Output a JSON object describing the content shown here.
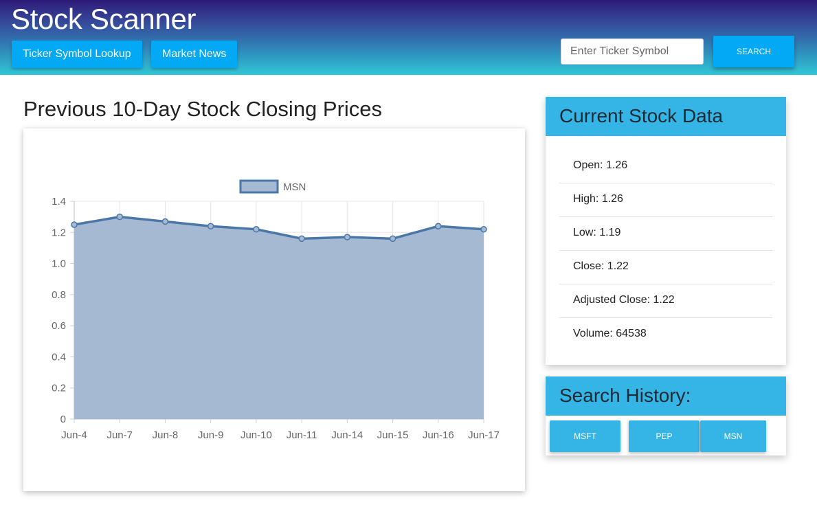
{
  "header": {
    "app_title": "Stock Scanner",
    "nav": {
      "lookup_label": "Ticker Symbol Lookup",
      "news_label": "Market News"
    },
    "search": {
      "placeholder": "Enter Ticker Symbol",
      "value": "",
      "button_label": "SEARCH"
    }
  },
  "chart_section": {
    "heading": "Previous 10-Day Stock Closing Prices"
  },
  "chart_data": {
    "type": "area",
    "x": [
      "Jun-4",
      "Jun-7",
      "Jun-8",
      "Jun-9",
      "Jun-10",
      "Jun-11",
      "Jun-14",
      "Jun-15",
      "Jun-16",
      "Jun-17"
    ],
    "series": [
      {
        "name": "MSN",
        "values": [
          1.25,
          1.3,
          1.27,
          1.24,
          1.22,
          1.16,
          1.17,
          1.16,
          1.24,
          1.22
        ]
      }
    ],
    "yticks": [
      "0",
      "0.2",
      "0.4",
      "0.6",
      "0.8",
      "1.0",
      "1.2",
      "1.4"
    ],
    "ylim": [
      0,
      1.4
    ],
    "grid": true,
    "legend_position": "top",
    "colors": {
      "line": "#4a76a8",
      "fill": "#a6b9d3",
      "grid": "#e5e5e5",
      "tick_text": "#666666"
    }
  },
  "stock_card": {
    "title": "Current Stock Data",
    "rows": [
      {
        "text": "Open: 1.26"
      },
      {
        "text": "High: 1.26"
      },
      {
        "text": "Low: 1.19"
      },
      {
        "text": "Close: 1.22"
      },
      {
        "text": "Adjusted Close: 1.22"
      },
      {
        "text": "Volume: 64538"
      }
    ]
  },
  "history_card": {
    "title": "Search History:",
    "items": [
      {
        "label": "MSFT"
      },
      {
        "label": "PEP"
      },
      {
        "label": "MSN"
      }
    ]
  },
  "theme": {
    "accent": "#03a9f4",
    "card_header": "#35b5e5"
  }
}
